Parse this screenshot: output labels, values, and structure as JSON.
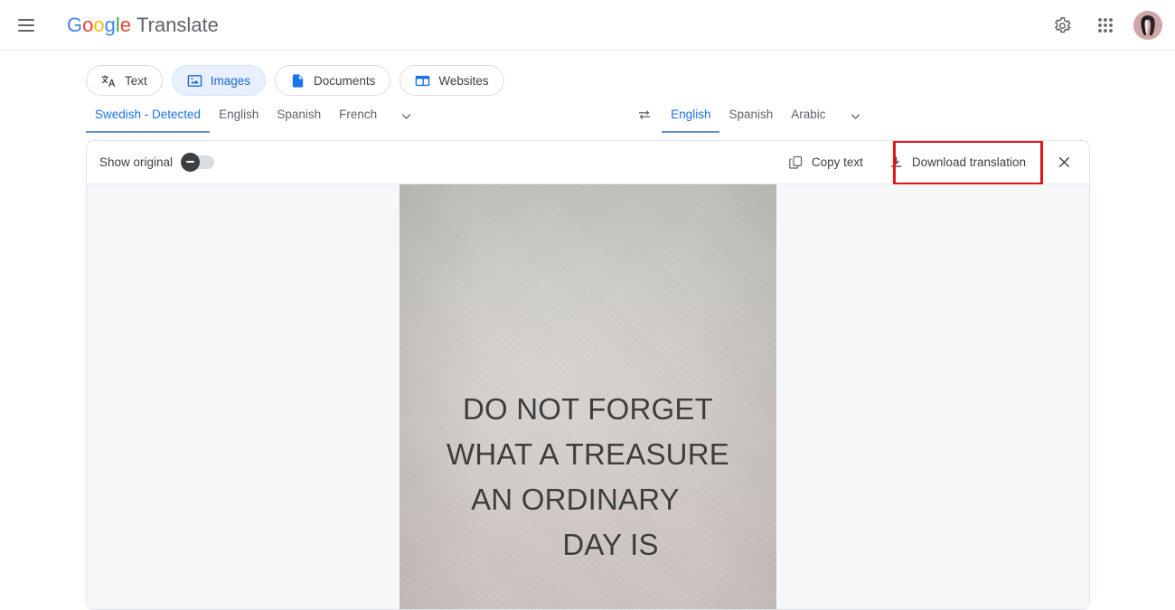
{
  "app": {
    "brand_google": [
      "G",
      "o",
      "o",
      "g",
      "l",
      "e"
    ],
    "brand_product": "Translate"
  },
  "appbar": {
    "menu_icon": "hamburger-menu-icon",
    "settings_icon": "gear-icon",
    "apps_icon": "apps-grid-icon",
    "avatar": "user-avatar"
  },
  "modes": [
    {
      "label": "Text",
      "icon": "translate-icon",
      "active": false
    },
    {
      "label": "Images",
      "icon": "image-icon",
      "active": true
    },
    {
      "label": "Documents",
      "icon": "document-icon",
      "active": false
    },
    {
      "label": "Websites",
      "icon": "website-icon",
      "active": false
    }
  ],
  "source_languages": [
    {
      "label": "Swedish - Detected",
      "active": true
    },
    {
      "label": "English",
      "active": false
    },
    {
      "label": "Spanish",
      "active": false
    },
    {
      "label": "French",
      "active": false
    }
  ],
  "target_languages": [
    {
      "label": "English",
      "active": true
    },
    {
      "label": "Spanish",
      "active": false
    },
    {
      "label": "Arabic",
      "active": false
    }
  ],
  "swap_icon": "swap-languages-icon",
  "more_icon": "chevron-down-icon",
  "card_toolbar": {
    "show_original_label": "Show original",
    "show_original_on": false,
    "copy_text_label": "Copy text",
    "copy_text_icon": "copy-icon",
    "download_label": "Download translation",
    "download_icon": "download-icon",
    "close_icon": "close-icon"
  },
  "highlight": {
    "target": "Download translation",
    "color": "#e81414"
  },
  "translated_image": {
    "line1": "DO NOT FORGET",
    "line2": "WHAT A TREASURE",
    "line3": "AN ORDINARY",
    "line4": "DAY IS"
  },
  "colors": {
    "accent_blue": "#1a73e8",
    "active_tab_bg": "#e8f0fe",
    "text_primary": "#3c4043",
    "text_secondary": "#5f6368",
    "card_bg": "#f5f7f9",
    "highlight_red": "#e81414"
  }
}
